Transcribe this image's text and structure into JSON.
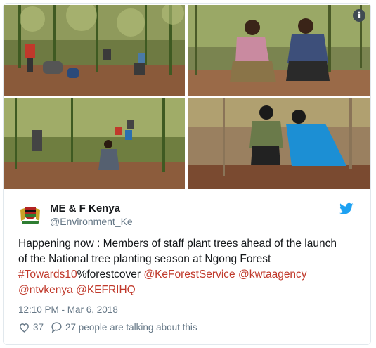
{
  "tweet": {
    "author_name": "ME & F Kenya",
    "author_handle": "@Environment_Ke",
    "text": {
      "line1": "Happening now : Members of staff plant trees ahead of the launch",
      "line2": "of the National tree planting season at Ngong Forest",
      "hashtag": "#Towards10",
      "after_hashtag": "%forestcover ",
      "mention1": "@KeForestService",
      "mention2": "@kwtaagency",
      "mention3": "@ntvkenya",
      "mention4": "@KEFRIHQ"
    },
    "timestamp": "12:10 PM - Mar 6, 2018",
    "likes": "37",
    "talking": "27 people are talking about this"
  },
  "media": {
    "info_symbol": "i",
    "photos": [
      "tree-planting-group",
      "planting-pair-men",
      "planting-field-workers",
      "planting-pair-women"
    ]
  },
  "icons": {
    "info": "info-icon",
    "bird": "twitter-bird-icon",
    "like": "heart-icon",
    "reply": "comment-icon",
    "avatar": "kenya-coat-of-arms"
  },
  "colors": {
    "link": "#c0392b",
    "twitter_blue": "#1da1f2",
    "secondary_text": "#657786"
  }
}
